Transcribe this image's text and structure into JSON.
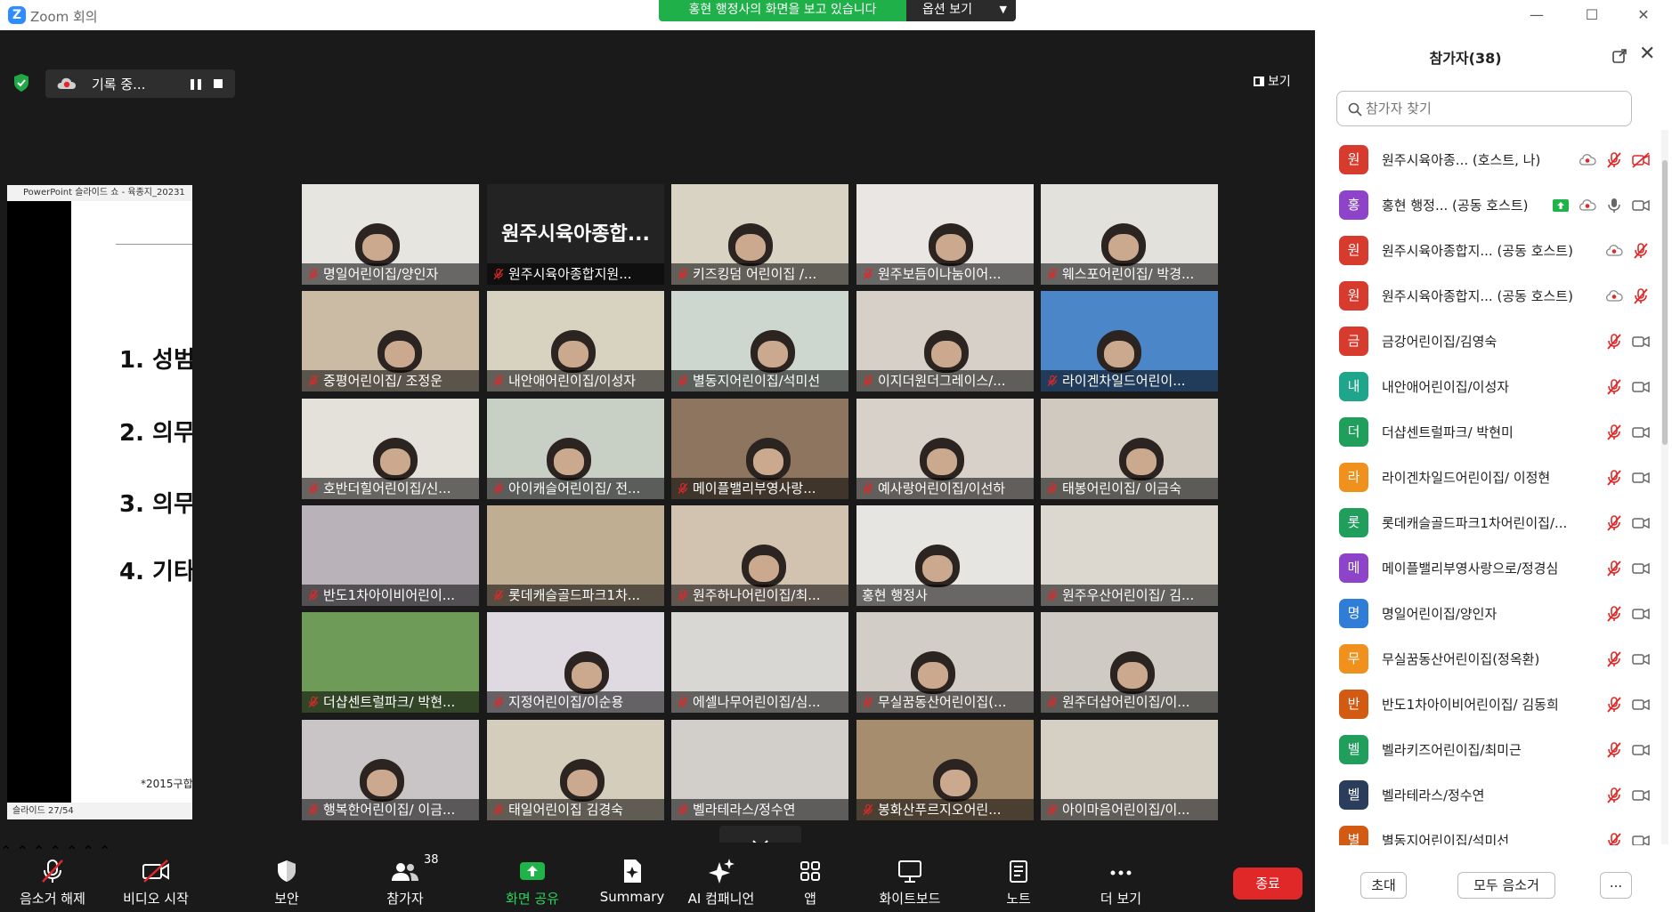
{
  "window": {
    "title": "Zoom 회의",
    "logo_letter": "Z"
  },
  "banner": {
    "text": "홍현 행정사의 화면을 보고 있습니다",
    "options_label": "옵션 보기"
  },
  "recording": {
    "label": "기록 중..."
  },
  "view": {
    "label": "보기"
  },
  "slide": {
    "app_title": "PowerPoint 슬라이드 쇼  -  육종지_20231",
    "bullets": [
      "1. 성범",
      "2. 의무",
      "3. 의무",
      "4. 기타"
    ],
    "footnote": "*2015구합",
    "status": "슬라이드 27/54"
  },
  "tiles": [
    {
      "name": "명일어린이집/양인자",
      "muted": true,
      "bg": "#e7e5df",
      "person": true
    },
    {
      "name": "원주시육아종합지원...",
      "muted": true,
      "textonly": true,
      "big": "원주시육아종합..."
    },
    {
      "name": "키즈킹덤 어린이집 /...",
      "muted": true,
      "bg": "#d9d3c4",
      "person": true
    },
    {
      "name": "원주보듬이나눔이어...",
      "muted": true,
      "bg": "#e9e6e3",
      "person": true
    },
    {
      "name": "웨스포어린이집/ 박경...",
      "muted": true,
      "bg": "#e3e1dc",
      "person": true
    },
    {
      "name": "중평어린이집/ 조정운",
      "muted": true,
      "bg": "#cbbba4",
      "person": true
    },
    {
      "name": "내안애어린이집/이성자",
      "muted": true,
      "bg": "#d8d2c1",
      "person": true
    },
    {
      "name": "별동지어린이집/석미선",
      "muted": true,
      "bg": "#cdd6cf",
      "person": true
    },
    {
      "name": "이지더원더그레이스/...",
      "muted": true,
      "bg": "#d6d0c8",
      "person": true
    },
    {
      "name": "라이겐차일드어린이...",
      "muted": true,
      "bg": "#4a86c8",
      "person": true
    },
    {
      "name": "호반더힐어린이집/신...",
      "muted": true,
      "bg": "#e4e0da",
      "person": true
    },
    {
      "name": "아이캐슬어린이집/ 전...",
      "muted": true,
      "bg": "#c8cfc5",
      "person": true
    },
    {
      "name": "메이플밸리부영사랑...",
      "muted": true,
      "bg": "#8d7560",
      "person": true
    },
    {
      "name": "예사랑어린이집/이선하",
      "muted": true,
      "bg": "#d7d1c9",
      "person": true
    },
    {
      "name": "태봉어린이집/ 이금숙",
      "muted": true,
      "bg": "#cfc9c0",
      "person": true
    },
    {
      "name": "반도1차아이비어린이...",
      "muted": true,
      "bg": "#b9b2b8",
      "person": false
    },
    {
      "name": "롯데캐슬골드파크1차...",
      "muted": true,
      "bg": "#bfae92",
      "person": false
    },
    {
      "name": "원주하나어린이집/최...",
      "muted": true,
      "bg": "#d2c2b0",
      "person": true
    },
    {
      "name": "홍현 행정사",
      "muted": false,
      "bg": "#e7e5e1",
      "person": true,
      "active": true
    },
    {
      "name": "원주우산어린이집/ 김...",
      "muted": true,
      "bg": "#dcd7cf",
      "person": false
    },
    {
      "name": "더샵센트럴파크/ 박현...",
      "muted": true,
      "bg": "#6f9b58",
      "person": false
    },
    {
      "name": "지정어린이집/이순용",
      "muted": true,
      "bg": "#dfd9e1",
      "person": true
    },
    {
      "name": "에셀나무어린이집/심...",
      "muted": true,
      "bg": "#d9d7d4",
      "person": false
    },
    {
      "name": "무실꿈동산어린이집(...",
      "muted": true,
      "bg": "#d3cdc8",
      "person": true
    },
    {
      "name": "원주더샵어린이집/이...",
      "muted": true,
      "bg": "#cfcac4",
      "person": true
    },
    {
      "name": "행복한어린이집/ 이금...",
      "muted": true,
      "bg": "#c9c4c5",
      "person": true
    },
    {
      "name": "태일어린이집 김경숙",
      "muted": true,
      "bg": "#d4cdbb",
      "person": true
    },
    {
      "name": "벨라테라스/정수연",
      "muted": true,
      "bg": "#d2cfcb",
      "person": false
    },
    {
      "name": "봉화산푸르지오어린...",
      "muted": true,
      "bg": "#a58d6e",
      "person": true
    },
    {
      "name": "아이마음어린이집/이...",
      "muted": true,
      "bg": "#d6cfc4",
      "person": false
    }
  ],
  "toolbar": {
    "unmute": "음소거 해제",
    "start_video": "비디오 시작",
    "security": "보안",
    "participants": "참가자",
    "participants_count": "38",
    "share": "화면 공유",
    "summary": "Summary",
    "ai": "AI 컴패니언",
    "apps": "앱",
    "whiteboard": "화이트보드",
    "notes": "노트",
    "more": "더 보기",
    "end": "종료"
  },
  "panel": {
    "title": "참가자(38)",
    "search_placeholder": "참가자 찾기",
    "invite": "초대",
    "mute_all": "모두 음소거",
    "more": "..."
  },
  "participants": [
    {
      "avatar": "원",
      "color": "#d63b2e",
      "name": "원주시육아종...    (호스트, 나)",
      "icons": [
        "rec",
        "mic-off",
        "video-off"
      ]
    },
    {
      "avatar": "홍",
      "color": "#8e44c9",
      "name": "홍현 행정... (공동 호스트)",
      "icons": [
        "share",
        "rec",
        "mic",
        "video"
      ]
    },
    {
      "avatar": "원",
      "color": "#d63b2e",
      "name": "원주시육아종합지... (공동 호스트)",
      "icons": [
        "rec",
        "mic-off"
      ]
    },
    {
      "avatar": "원",
      "color": "#d63b2e",
      "name": "원주시육아종합지... (공동 호스트)",
      "icons": [
        "rec",
        "mic-off"
      ]
    },
    {
      "avatar": "금",
      "color": "#d63b2e",
      "name": "금강어린이집/김영숙",
      "icons": [
        "mic-off",
        "video"
      ]
    },
    {
      "avatar": "내",
      "color": "#1fa58b",
      "name": "내안애어린이집/이성자",
      "icons": [
        "mic-off",
        "video"
      ]
    },
    {
      "avatar": "더",
      "color": "#1f9e5c",
      "name": "더샵센트럴파크/ 박현미",
      "icons": [
        "mic-off",
        "video"
      ]
    },
    {
      "avatar": "라",
      "color": "#f0901d",
      "name": "라이겐차일드어린이집/ 이정현",
      "icons": [
        "mic-off",
        "video"
      ]
    },
    {
      "avatar": "롯",
      "color": "#1f9e5c",
      "name": "롯데캐슬골드파크1차어린이집/...",
      "icons": [
        "mic-off",
        "video"
      ]
    },
    {
      "avatar": "메",
      "color": "#8e44c9",
      "name": "메이플밸리부영사랑으로/정경심",
      "icons": [
        "mic-off",
        "video"
      ]
    },
    {
      "avatar": "명",
      "color": "#2f7dd6",
      "name": "명일어린이집/양인자",
      "icons": [
        "mic-off",
        "video"
      ]
    },
    {
      "avatar": "무",
      "color": "#f0901d",
      "name": "무실꿈동산어린이집(정옥환)",
      "icons": [
        "mic-off",
        "video"
      ]
    },
    {
      "avatar": "반",
      "color": "#d25a12",
      "name": "반도1차아이비어린이집/ 김동희",
      "icons": [
        "mic-off",
        "video"
      ]
    },
    {
      "avatar": "벨",
      "color": "#1f9e5c",
      "name": "벨라키즈어린이집/최미근",
      "icons": [
        "mic-off",
        "video"
      ]
    },
    {
      "avatar": "벨",
      "color": "#2a3e5c",
      "name": "벨라테라스/정수연",
      "icons": [
        "mic-off",
        "video"
      ]
    },
    {
      "avatar": "별",
      "color": "#d25a12",
      "name": "별동지어린이집/석미선",
      "icons": [
        "mic-off",
        "video"
      ]
    }
  ]
}
